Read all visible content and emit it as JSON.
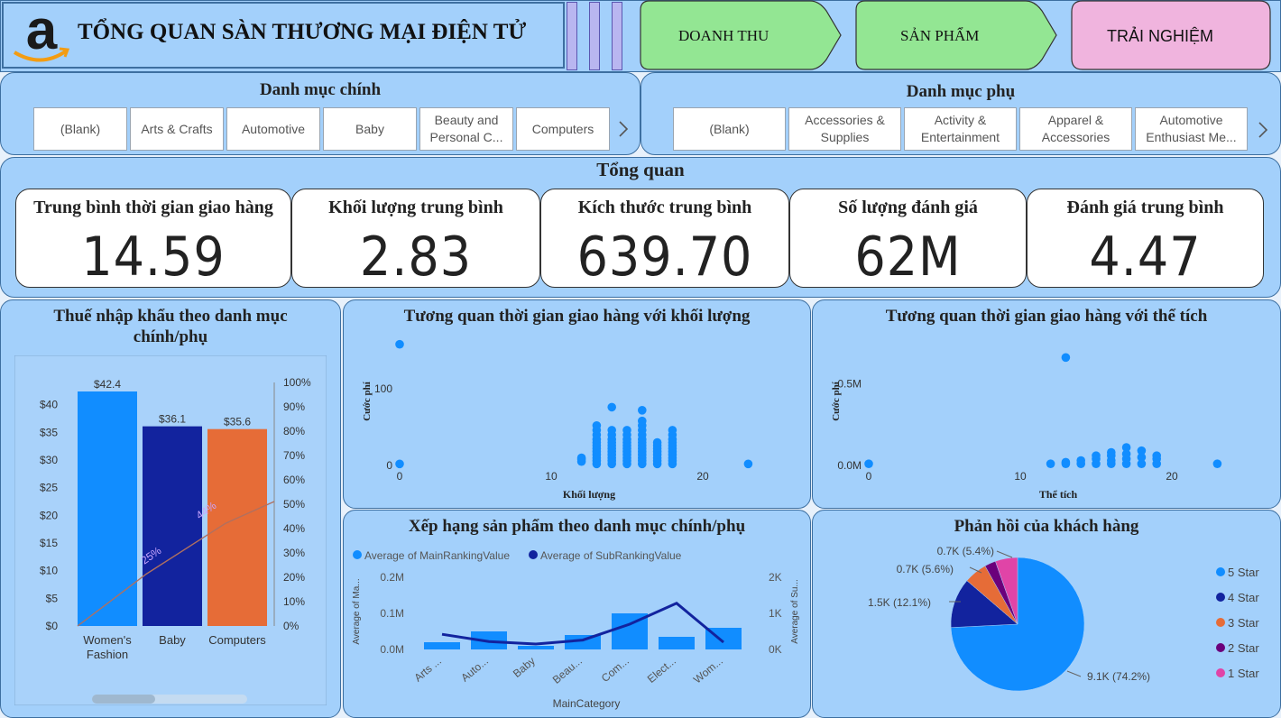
{
  "header": {
    "title": "TỔNG QUAN SÀN THƯƠNG MẠI ĐIỆN TỬ",
    "logo": "amazon-logo",
    "nav": [
      {
        "label": "DOANH THU",
        "color": "#93e693"
      },
      {
        "label": "SẢN PHẨM",
        "color": "#93e693"
      },
      {
        "label": "TRẢI NGHIỆM",
        "color": "#f0b4de"
      }
    ]
  },
  "slicers": {
    "main": {
      "title": "Danh mục chính",
      "items": [
        "(Blank)",
        "Arts & Crafts",
        "Automotive",
        "Baby",
        "Beauty and Personal C...",
        "Computers"
      ]
    },
    "sub": {
      "title": "Danh mục phụ",
      "items": [
        "(Blank)",
        "Accessories & Supplies",
        "Activity & Entertainment",
        "Apparel & Accessories",
        "Automotive Enthusiast Me..."
      ]
    },
    "next_icon": "chevron-right-icon"
  },
  "overview": {
    "title": "Tổng quan",
    "kpis": [
      {
        "label": "Trung bình thời gian giao hàng",
        "value": "14.59"
      },
      {
        "label": "Khối lượng trung bình",
        "value": "2.83"
      },
      {
        "label": "Kích thước trung bình",
        "value": "639.70"
      },
      {
        "label": "Số lượng đánh giá",
        "value": "62M"
      },
      {
        "label": "Đánh giá trung bình",
        "value": "4.47"
      }
    ]
  },
  "chart_titles": {
    "pareto": "Thuế nhập khẩu theo danh mục chính/phụ",
    "scatter_weight": "Tương quan thời gian giao hàng với khối lượng",
    "scatter_volume": "Tương quan thời gian giao hàng với thể tích",
    "ranking": "Xếp hạng sản phẩm theo danh mục chính/phụ",
    "feedback": "Phản hồi của khách hàng"
  },
  "chart_data": [
    {
      "type": "bar",
      "title": "Thuế nhập khẩu theo danh mục chính/phụ",
      "categories": [
        "Women's Fashion",
        "Baby",
        "Computers"
      ],
      "series": [
        {
          "values": [
            42.4,
            36.1,
            35.6
          ]
        }
      ],
      "bar_colors": [
        "#118dff",
        "#12239e",
        "#e66c37"
      ],
      "data_labels": [
        "$42.4",
        "$36.1",
        "$35.6"
      ],
      "cumulative_line": {
        "values": [
          0.0,
          25,
          44,
          60
        ],
        "labels": [
          "25%",
          "44%"
        ],
        "color": "#b07060"
      },
      "ylim": [
        0,
        42.4
      ],
      "y_ticks": [
        "$0",
        "$5",
        "$10",
        "$15",
        "$20",
        "$25",
        "$30",
        "$35",
        "$40"
      ],
      "y2_ticks": [
        "0%",
        "10%",
        "20%",
        "30%",
        "40%",
        "50%",
        "60%",
        "70%",
        "80%",
        "90%",
        "100%"
      ]
    },
    {
      "type": "scatter",
      "title": "Tương quan thời gian giao hàng với khối lượng",
      "xlabel": "Khối lượng",
      "ylabel": "Cước phí",
      "x_ticks": [
        "0",
        "10",
        "20"
      ],
      "y_ticks": [
        "0",
        "100"
      ],
      "xlim": [
        0,
        25
      ],
      "ylim": [
        0,
        160
      ],
      "points": [
        [
          0,
          158
        ],
        [
          0,
          2
        ],
        [
          12,
          5
        ],
        [
          12,
          8
        ],
        [
          12,
          10
        ],
        [
          13,
          2
        ],
        [
          13,
          6
        ],
        [
          13,
          10
        ],
        [
          13,
          14
        ],
        [
          13,
          18
        ],
        [
          13,
          22
        ],
        [
          13,
          26
        ],
        [
          13,
          30
        ],
        [
          13,
          34
        ],
        [
          13,
          40
        ],
        [
          13,
          46
        ],
        [
          13,
          52
        ],
        [
          14,
          2
        ],
        [
          14,
          6
        ],
        [
          14,
          10
        ],
        [
          14,
          14
        ],
        [
          14,
          18
        ],
        [
          14,
          22
        ],
        [
          14,
          26
        ],
        [
          14,
          30
        ],
        [
          14,
          34
        ],
        [
          14,
          40
        ],
        [
          14,
          46
        ],
        [
          14,
          76
        ],
        [
          15,
          2
        ],
        [
          15,
          6
        ],
        [
          15,
          10
        ],
        [
          15,
          14
        ],
        [
          15,
          18
        ],
        [
          15,
          22
        ],
        [
          15,
          26
        ],
        [
          15,
          30
        ],
        [
          15,
          34
        ],
        [
          15,
          40
        ],
        [
          15,
          46
        ],
        [
          16,
          2
        ],
        [
          16,
          6
        ],
        [
          16,
          10
        ],
        [
          16,
          14
        ],
        [
          16,
          18
        ],
        [
          16,
          22
        ],
        [
          16,
          26
        ],
        [
          16,
          30
        ],
        [
          16,
          34
        ],
        [
          16,
          40
        ],
        [
          16,
          46
        ],
        [
          16,
          52
        ],
        [
          16,
          58
        ],
        [
          16,
          72
        ],
        [
          17,
          2
        ],
        [
          17,
          6
        ],
        [
          17,
          10
        ],
        [
          17,
          14
        ],
        [
          17,
          18
        ],
        [
          17,
          22
        ],
        [
          17,
          26
        ],
        [
          17,
          30
        ],
        [
          18,
          2
        ],
        [
          18,
          6
        ],
        [
          18,
          10
        ],
        [
          18,
          14
        ],
        [
          18,
          18
        ],
        [
          18,
          22
        ],
        [
          18,
          26
        ],
        [
          18,
          30
        ],
        [
          18,
          34
        ],
        [
          18,
          40
        ],
        [
          18,
          46
        ],
        [
          23,
          2
        ]
      ],
      "color": "#118dff"
    },
    {
      "type": "scatter",
      "title": "Tương quan thời gian giao hàng với thể tích",
      "xlabel": "Thể tích",
      "ylabel": "Cước phí",
      "x_ticks": [
        "0",
        "10",
        "20"
      ],
      "y_ticks": [
        "0.0M",
        "0.5M"
      ],
      "xlim": [
        0,
        25
      ],
      "ylim": [
        0,
        0.75
      ],
      "points": [
        [
          0,
          0.01
        ],
        [
          12,
          0.01
        ],
        [
          13,
          0.01
        ],
        [
          13,
          0.02
        ],
        [
          14,
          0.01
        ],
        [
          14,
          0.03
        ],
        [
          15,
          0.01
        ],
        [
          15,
          0.04
        ],
        [
          15,
          0.06
        ],
        [
          16,
          0.01
        ],
        [
          16,
          0.03
        ],
        [
          16,
          0.06
        ],
        [
          16,
          0.08
        ],
        [
          17,
          0.01
        ],
        [
          17,
          0.04
        ],
        [
          17,
          0.07
        ],
        [
          17,
          0.11
        ],
        [
          18,
          0.01
        ],
        [
          18,
          0.05
        ],
        [
          18,
          0.09
        ],
        [
          19,
          0.01
        ],
        [
          19,
          0.04
        ],
        [
          19,
          0.06
        ],
        [
          13,
          0.66
        ],
        [
          23,
          0.01
        ]
      ],
      "color": "#118dff"
    },
    {
      "type": "bar",
      "title": "Xếp hạng sản phẩm theo danh mục chính/phụ",
      "xlabel": "MainCategory",
      "ylabel": "Average of Ma...",
      "y2label": "Average of Su...",
      "categories": [
        "Arts ...",
        "Auto...",
        "Baby",
        "Beau...",
        "Com...",
        "Elect...",
        "Wom..."
      ],
      "series": [
        {
          "name": "Average of MainRankingValue",
          "type": "bar",
          "values": [
            0.02,
            0.05,
            0.01,
            0.04,
            0.1,
            0.035,
            0.06
          ],
          "color": "#118dff"
        },
        {
          "name": "Average of SubRankingValue",
          "type": "line",
          "values": [
            0.42,
            0.22,
            0.15,
            0.26,
            0.7,
            1.28,
            0.2
          ],
          "color": "#12239e"
        }
      ],
      "y_ticks": [
        "0.0M",
        "0.1M",
        "0.2M"
      ],
      "y2_ticks": [
        "0K",
        "1K",
        "2K"
      ],
      "ylim": [
        0,
        0.2
      ],
      "y2lim": [
        0,
        2
      ]
    },
    {
      "type": "pie",
      "title": "Phản hồi của khách hàng",
      "slices": [
        {
          "label": "5 Star",
          "value": 74.2,
          "text": "9.1K (74.2%)",
          "color": "#118dff"
        },
        {
          "label": "4 Star",
          "value": 12.1,
          "text": "1.5K (12.1%)",
          "color": "#12239e"
        },
        {
          "label": "3 Star",
          "value": 5.6,
          "text": "0.7K (5.6%)",
          "color": "#e66c37"
        },
        {
          "label": "2 Star",
          "value": 2.7,
          "text": "",
          "color": "#6b007b"
        },
        {
          "label": "1 Star",
          "value": 5.4,
          "text": "0.7K (5.4%)",
          "color": "#e044a7"
        }
      ]
    }
  ]
}
